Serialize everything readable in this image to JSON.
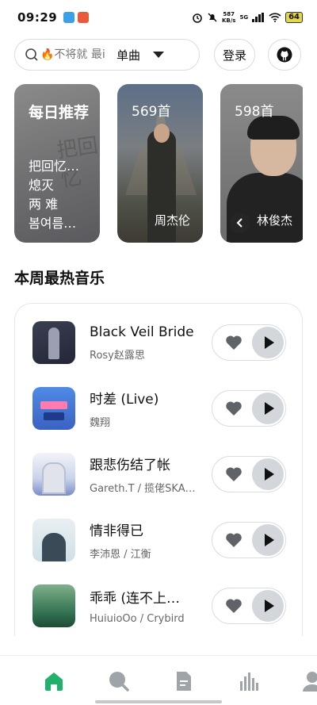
{
  "status_bar": {
    "time": "09:29",
    "net_speed_value": "587",
    "net_speed_unit": "KB/s",
    "network": "5G",
    "battery": "64"
  },
  "search": {
    "placeholder": "🔥不将就 最i",
    "type_selected": "单曲",
    "login_label": "登录"
  },
  "featured": [
    {
      "type": "daily",
      "title": "每日推荐",
      "lines": [
        "把回忆…",
        "熄灭",
        "两 难",
        "봄여름…"
      ]
    },
    {
      "type": "artist",
      "count": "569首",
      "name": "周杰伦"
    },
    {
      "type": "artist",
      "count": "598首",
      "name": "林俊杰"
    }
  ],
  "section": {
    "title": "本周最热音乐"
  },
  "songs": [
    {
      "title": "Black Veil Bride",
      "artist": "Rosy赵露思"
    },
    {
      "title": "时差 (Live)",
      "artist": "魏翔"
    },
    {
      "title": "跟悲伤结了帐",
      "artist": "Gareth.T / 揽佬SKA…"
    },
    {
      "title": "情非得已",
      "artist": "李沛恩 / 江衡"
    },
    {
      "title": "乖乖 (连不上…",
      "artist": "HuiuioOo / Crybird"
    }
  ],
  "nav": {
    "items": [
      "home-icon",
      "search-icon",
      "playlist-icon",
      "chart-icon",
      "user-icon"
    ],
    "active": "home-icon"
  },
  "colors": {
    "accent": "#20b26b",
    "inactive": "#9ea4a8",
    "play_bg": "#d3d7db",
    "border": "#d7dde0"
  }
}
